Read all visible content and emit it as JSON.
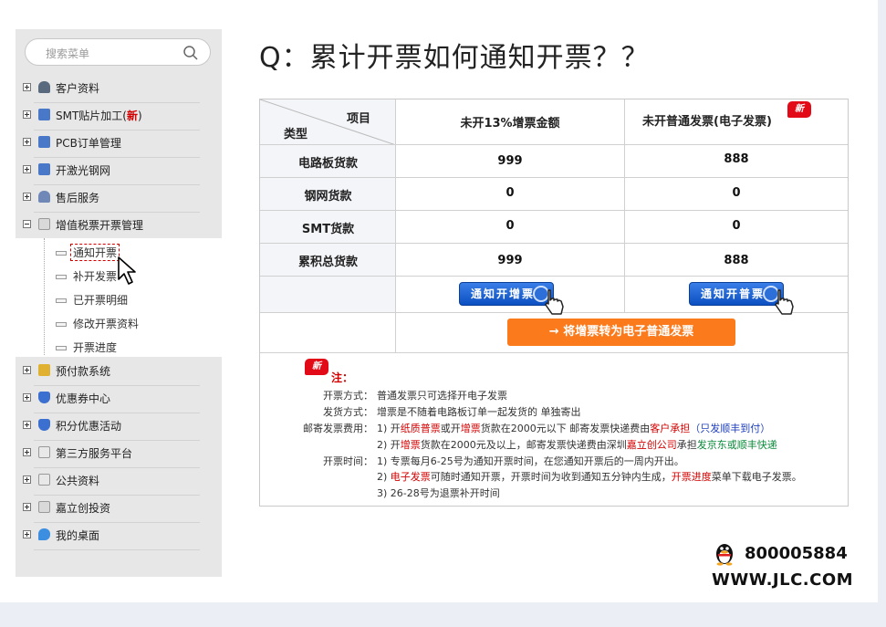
{
  "search": {
    "placeholder": "搜索菜单"
  },
  "sidebar": {
    "items_top": [
      {
        "label": "客户资料",
        "icon": "user-icon"
      },
      {
        "label": "SMT贴片加工(",
        "badge": "新",
        "suffix": ")",
        "icon": "calendar-icon"
      },
      {
        "label": "PCB订单管理",
        "icon": "calendar-icon"
      },
      {
        "label": "开激光钢网",
        "icon": "calendar-icon"
      },
      {
        "label": "售后服务",
        "icon": "person-icon"
      },
      {
        "label": "增值税票开票管理",
        "icon": "document-icon"
      }
    ],
    "sub_items": [
      {
        "label": "通知开票"
      },
      {
        "label": "补开发票"
      },
      {
        "label": "已开票明细"
      },
      {
        "label": "修改开票资料"
      },
      {
        "label": "开票进度"
      }
    ],
    "items_bottom": [
      {
        "label": "预付款系统",
        "icon": "coins-icon"
      },
      {
        "label": "优惠券中心",
        "icon": "shield-icon"
      },
      {
        "label": "积分优惠活动",
        "icon": "shield-icon"
      },
      {
        "label": "第三方服务平台",
        "icon": "window-icon"
      },
      {
        "label": "公共资料",
        "icon": "window-icon"
      },
      {
        "label": "嘉立创投资",
        "icon": "document-icon"
      },
      {
        "label": "我的桌面",
        "icon": "chat-icon"
      }
    ]
  },
  "title": "Q：累计开票如何通知开票？？",
  "table": {
    "corner_item": "项目",
    "corner_type": "类型",
    "col1": "未开13%增票金额",
    "col2": "未开普通发票(电子发票)",
    "new_label": "新",
    "rows": [
      {
        "label": "电路板货款",
        "v1": "999",
        "v2": "888"
      },
      {
        "label": "钢网货款",
        "v1": "0",
        "v2": "0"
      },
      {
        "label": "SMT货款",
        "v1": "0",
        "v2": "0"
      },
      {
        "label": "累积总货款",
        "v1": "999",
        "v2": "888"
      }
    ],
    "btn1": "通知开增票",
    "btn2": "通知开普票",
    "convert_btn": "→ 将增票转为电子普通发票"
  },
  "notes": {
    "badge": "新",
    "heading": "注：",
    "k1": "开票方式：",
    "v1": "普通发票只可选择开电子发票",
    "k2": "发货方式：",
    "v2": "增票是不随着电路板订单一起发货的 单独寄出",
    "k3": "邮寄发票费用：",
    "v3a_1": "1) 开",
    "v3a_2": "纸质普票",
    "v3a_3": "或开",
    "v3a_4": "增票",
    "v3a_5": "货款在2000元以下 邮寄发票快递费由",
    "v3a_6": "客户承担",
    "v3a_7": "（只发顺丰到付）",
    "v3b_1": "2) 开",
    "v3b_2": "增票",
    "v3b_3": "货款在2000元及以上，邮寄发票快递费由深圳",
    "v3b_4": "嘉立创公司",
    "v3b_5": "承担",
    "v3b_6": "发京东或顺丰快递",
    "k4": "开票时间：",
    "v4a": "1) 专票每月6-25号为通知开票时间，在您通知开票后的一周内开出。",
    "v4b_1": "2) ",
    "v4b_2": "电子发票",
    "v4b_3": "可随时通知开票，开票时间为收到通知五分钟内生成，",
    "v4b_4": "开票进度",
    "v4b_5": "菜单下载电子发票。",
    "v4c": "3) 26-28号为退票补开时间"
  },
  "footer": {
    "phone": "800005884",
    "site": "WWW.JLC.COM"
  },
  "colors": {
    "accent_red": "#d40000",
    "blue_button": "#0b4fc2",
    "orange_button": "#fa7a1c"
  }
}
